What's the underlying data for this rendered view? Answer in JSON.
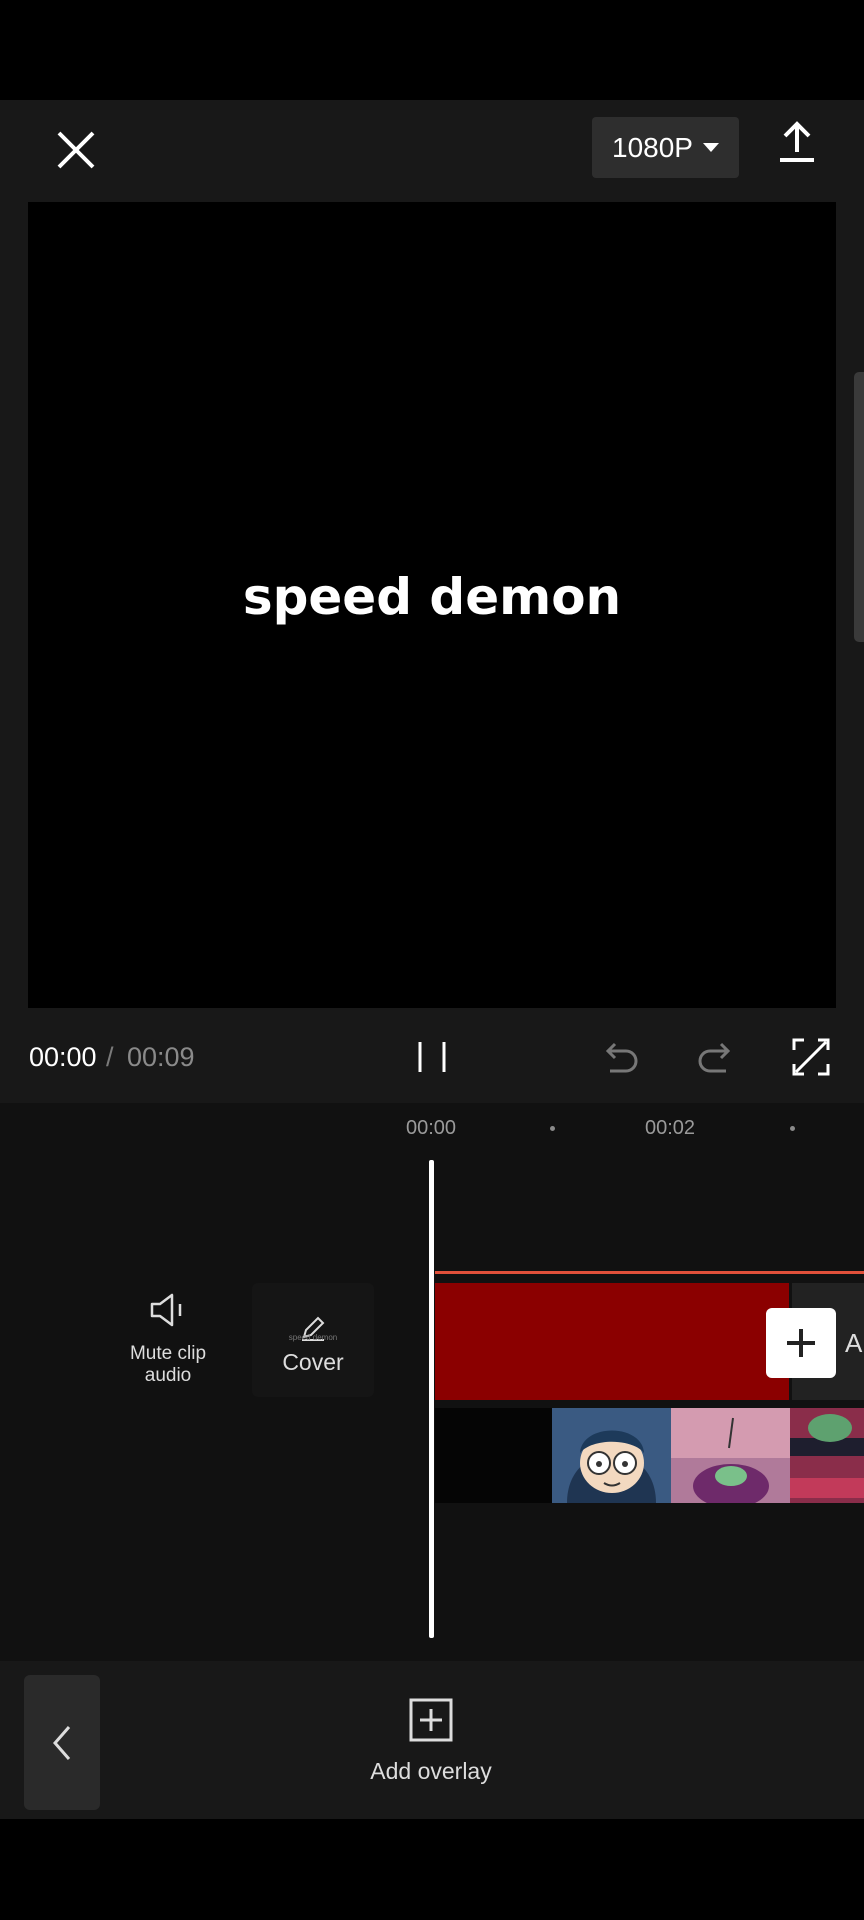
{
  "topbar": {
    "resolution": "1080P"
  },
  "preview": {
    "caption": "speed demon"
  },
  "controls": {
    "current_time": "00:00",
    "separator": "/",
    "total_time": "00:09"
  },
  "timeline": {
    "ticks": [
      "00:00",
      "00:02"
    ],
    "mute_label": "Mute clip audio",
    "cover_small_text": "speed demon",
    "cover_label": "Cover",
    "add_partial_label": "A"
  },
  "bottombar": {
    "add_overlay_label": "Add overlay"
  },
  "colors": {
    "background": "#000000",
    "panel": "#181818",
    "timeline": "#111111",
    "text_track": "#8b0000",
    "accent_line": "#e0503a"
  },
  "icons": [
    "close-icon",
    "chevron-down-icon",
    "export-icon",
    "pause-icon",
    "undo-icon",
    "redo-icon",
    "fullscreen-icon",
    "speaker-icon",
    "pencil-icon",
    "plus-icon",
    "chevron-left-icon",
    "add-overlay-icon"
  ]
}
